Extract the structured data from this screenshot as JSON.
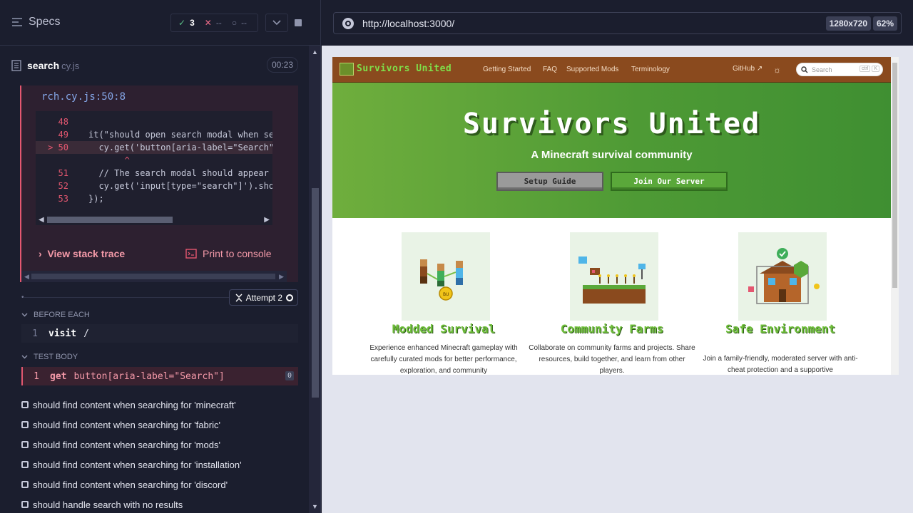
{
  "reporter": {
    "specs_label": "Specs",
    "stats": {
      "passed": "3",
      "failed": "--",
      "pending": "--"
    },
    "file": {
      "name": "search",
      "ext": "cy.js",
      "duration": "00:23"
    },
    "error": {
      "location": "rch.cy.js:50:8",
      "code_lines": [
        {
          "num": "48",
          "code": ""
        },
        {
          "num": "49",
          "code": "it(\"should open search modal when se"
        },
        {
          "num": "> 50",
          "code": "  cy.get('button[aria-label=\"Search\""
        },
        {
          "num": "",
          "code": "       ^"
        },
        {
          "num": "51",
          "code": "  // The search modal should appear"
        },
        {
          "num": "52",
          "code": "  cy.get('input[type=\"search\"]').sho"
        },
        {
          "num": "53",
          "code": "});"
        }
      ],
      "view_stack": "View stack trace",
      "print_console": "Print to console"
    },
    "attempt_label": "Attempt 2",
    "before_each_label": "BEFORE EACH",
    "before_each_cmds": [
      {
        "num": "1",
        "name": "visit",
        "msg": "/"
      }
    ],
    "test_body_label": "TEST BODY",
    "test_body_cmds": [
      {
        "num": "1",
        "name": "get",
        "msg": "button[aria-label=\"Search\"]",
        "badge": "0"
      }
    ],
    "tests": [
      "should find content when searching for 'minecraft'",
      "should find content when searching for 'fabric'",
      "should find content when searching for 'mods'",
      "should find content when searching for 'installation'",
      "should find content when searching for 'discord'",
      "should handle search with no results"
    ]
  },
  "aut": {
    "url": "http://localhost:3000/",
    "viewport_size": "1280x720",
    "zoom": "62%",
    "site": {
      "brand": "Survivors United",
      "nav_links": [
        "Getting Started",
        "FAQ",
        "Supported Mods",
        "Terminology"
      ],
      "github": "GitHub",
      "search_placeholder": "Search",
      "search_kbd": [
        "ctrl",
        "K"
      ],
      "hero_title": "Survivors United",
      "hero_subtitle": "A Minecraft survival community",
      "btn_setup": "Setup Guide",
      "btn_join": "Join Our Server",
      "features": [
        {
          "title": "Modded Survival",
          "desc": "Experience enhanced Minecraft gameplay with carefully curated mods for better performance, exploration, and community"
        },
        {
          "title": "Community Farms",
          "desc": "Collaborate on community farms and projects. Share resources, build together, and learn from other players."
        },
        {
          "title": "Safe Environment",
          "desc": "Join a family-friendly, moderated server with anti-cheat protection and a supportive"
        }
      ]
    }
  },
  "colors": {
    "fail_red": "#e45770",
    "pass_green": "#5bbf87",
    "hero_green": "#4e9a35",
    "nav_brown": "#8a4a1e"
  }
}
